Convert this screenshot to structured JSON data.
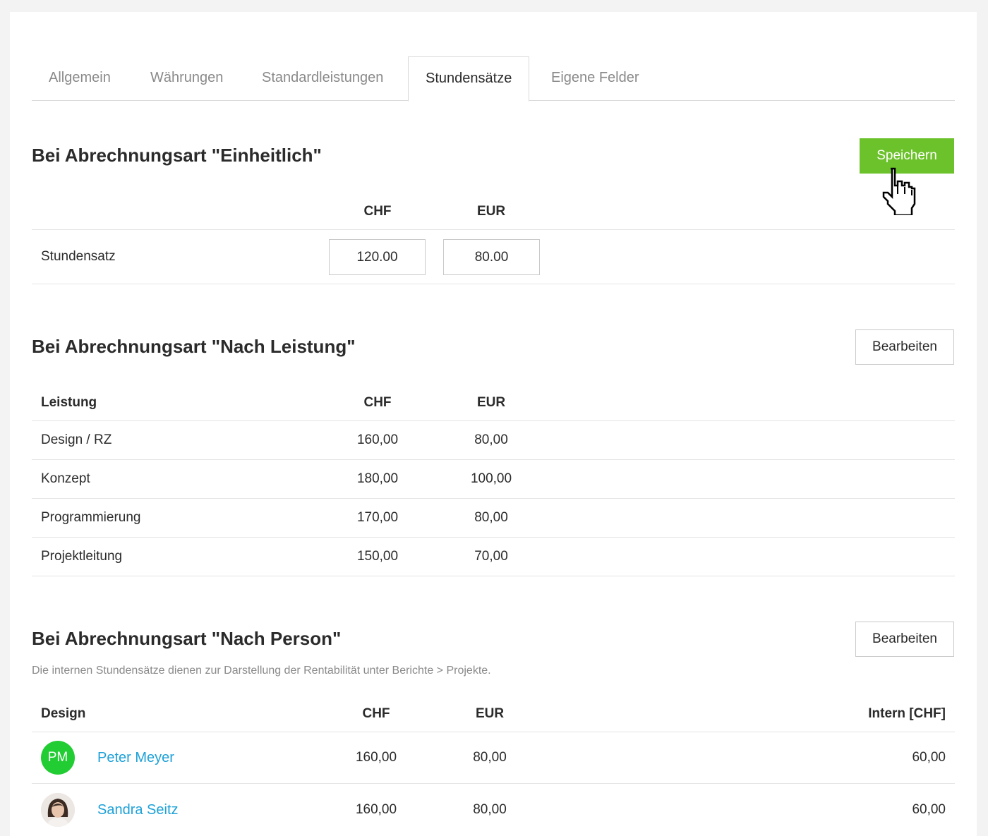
{
  "tabs": [
    {
      "label": "Allgemein",
      "active": false
    },
    {
      "label": "Währungen",
      "active": false
    },
    {
      "label": "Standardleistungen",
      "active": false
    },
    {
      "label": "Stundensätze",
      "active": true
    },
    {
      "label": "Eigene Felder",
      "active": false
    }
  ],
  "colors": {
    "accent_green": "#6cc22a",
    "link_blue": "#1da1d8",
    "avatar_green": "#22cc33"
  },
  "section_einheitlich": {
    "title": "Bei Abrechnungsart \"Einheitlich\"",
    "save_label": "Speichern",
    "columns": [
      "CHF",
      "EUR"
    ],
    "row_label": "Stundensatz",
    "values": [
      "120.00",
      "80.00"
    ]
  },
  "section_leistung": {
    "title": "Bei Abrechnungsart \"Nach Leistung\"",
    "edit_label": "Bearbeiten",
    "columns": [
      "Leistung",
      "CHF",
      "EUR"
    ],
    "rows": [
      {
        "name": "Design / RZ",
        "chf": "160,00",
        "eur": "80,00"
      },
      {
        "name": "Konzept",
        "chf": "180,00",
        "eur": "100,00"
      },
      {
        "name": "Programmierung",
        "chf": "170,00",
        "eur": "80,00"
      },
      {
        "name": "Projektleitung",
        "chf": "150,00",
        "eur": "70,00"
      }
    ]
  },
  "section_person": {
    "title": "Bei Abrechnungsart \"Nach Person\"",
    "edit_label": "Bearbeiten",
    "note": "Die internen Stundensätze dienen zur Darstellung der Rentabilität unter Berichte > Projekte.",
    "columns": [
      "Design",
      "CHF",
      "EUR",
      "Intern [CHF]"
    ],
    "rows": [
      {
        "initials": "PM",
        "avatar": "initials",
        "name": "Peter Meyer",
        "chf": "160,00",
        "eur": "80,00",
        "intern": "60,00"
      },
      {
        "initials": "",
        "avatar": "photo",
        "name": "Sandra Seitz",
        "chf": "160,00",
        "eur": "80,00",
        "intern": "60,00"
      }
    ]
  }
}
